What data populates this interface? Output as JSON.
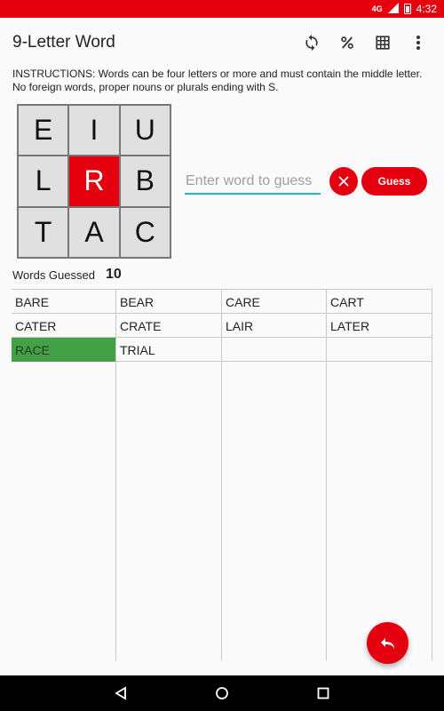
{
  "status_bar": {
    "network": "4G",
    "time": "4:32"
  },
  "app": {
    "title": "9-Letter Word",
    "actions": [
      {
        "icon": "refresh-icon"
      },
      {
        "icon": "percent-icon"
      },
      {
        "icon": "grid-icon"
      },
      {
        "icon": "more-vert-icon"
      }
    ]
  },
  "instructions": "INSTRUCTIONS: Words can be four letters or more and must contain the middle letter. No foreign words, proper nouns or plurals ending with S.",
  "letters": [
    "E",
    "I",
    "U",
    "L",
    "R",
    "B",
    "T",
    "A",
    "C"
  ],
  "input": {
    "placeholder": "Enter word to guess",
    "value": ""
  },
  "buttons": {
    "clear_icon": "close-icon",
    "guess_label": "Guess"
  },
  "words_guessed": {
    "label": "Words Guessed",
    "count": "10"
  },
  "guessed_words": [
    "BARE",
    "BEAR",
    "CARE",
    "CART",
    "CATER",
    "CRATE",
    "LAIR",
    "LATER",
    "RACE",
    "TRIAL"
  ],
  "highlighted_word": "RACE",
  "fab": {
    "icon": "undo-icon"
  },
  "colors": {
    "accent": "#e4000e",
    "highlight": "#43a047",
    "input_underline": "#2bb5c0"
  }
}
